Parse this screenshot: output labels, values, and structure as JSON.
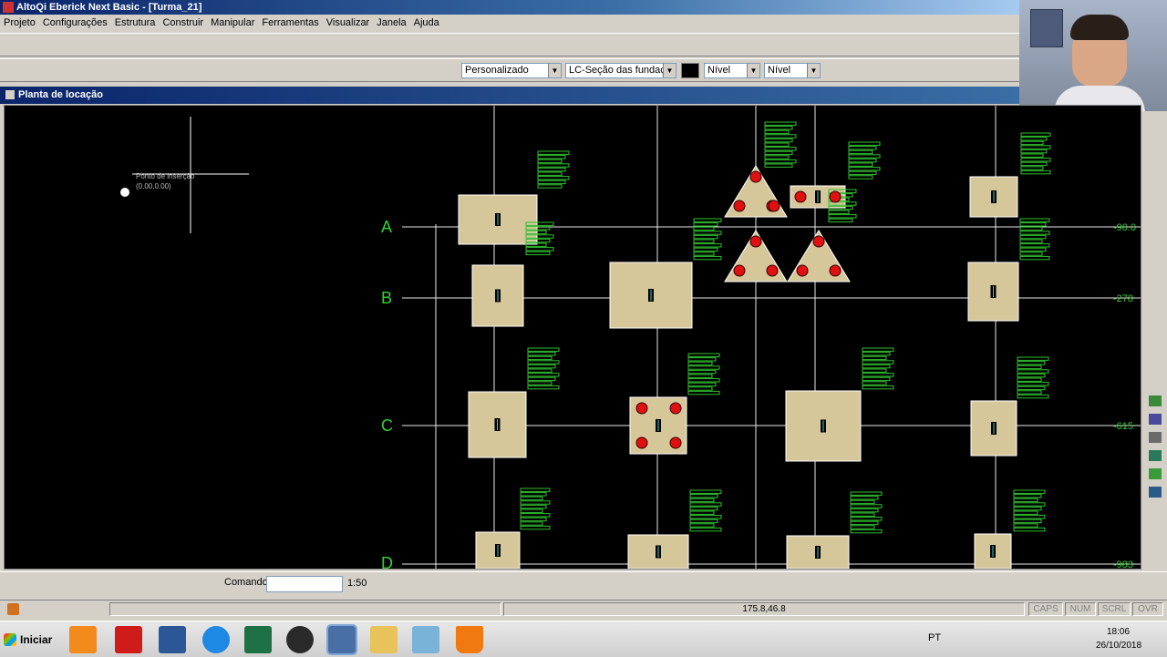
{
  "window": {
    "title": "AltoQi Eberick  Next Basic - [Turma_21]"
  },
  "menu": [
    "Projeto",
    "Configurações",
    "Estrutura",
    "Construir",
    "Manipular",
    "Ferramentas",
    "Visualizar",
    "Janela",
    "Ajuda"
  ],
  "toolbar2": {
    "combo_style": "Personalizado",
    "combo_layer": "LC-Seção das fundaçõe",
    "combo_level1": "Nível",
    "combo_level2": "Nível"
  },
  "document": {
    "title": "Planta de locação"
  },
  "drawing": {
    "origin_label": "Ponto de inserção",
    "origin_coords": "(0.00,0.00)",
    "axes": [
      {
        "label": "A",
        "value": "-90.0"
      },
      {
        "label": "B",
        "value": "-278"
      },
      {
        "label": "C",
        "value": "-615"
      },
      {
        "label": "D",
        "value": "-983"
      }
    ],
    "colors": {
      "background": "#000000",
      "footing": "#d6c79a",
      "axis_label": "#35d035",
      "rebar": "#2fbf2f",
      "pile": "#e01010"
    }
  },
  "command": {
    "label": "Comando",
    "value": "",
    "scale": "1:50"
  },
  "status": {
    "coords": "175.8,46.8",
    "caps": "CAPS",
    "num": "NUM",
    "scrl": "SCRL",
    "ovr": "OVR"
  },
  "taskbar": {
    "start": "Iniciar",
    "lang": "PT",
    "time": "18:06",
    "date": "26/10/2018",
    "apps": [
      "media-player-icon",
      "pdf-reader-icon",
      "word-icon",
      "browser-icon",
      "excel-icon",
      "obs-icon",
      "eberick-icon",
      "folder-icon",
      "notepad-icon",
      "vlc-icon"
    ]
  }
}
